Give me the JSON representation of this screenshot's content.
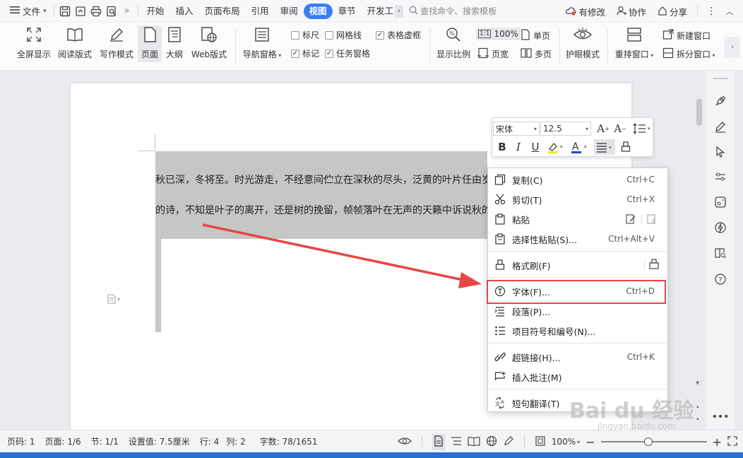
{
  "topbar": {
    "file_menu": "文件",
    "tabs": [
      "开始",
      "插入",
      "页面布局",
      "引用",
      "审阅",
      "视图",
      "章节",
      "开发工"
    ],
    "active_tab": "视图",
    "search_placeholder": "查找命令、搜索模板",
    "modified": "有修改",
    "collab": "协作",
    "share": "分享"
  },
  "ribbon": {
    "buttons": {
      "fullscreen": "全屏显示",
      "reading": "阅读版式",
      "writing": "写作模式",
      "page": "页面",
      "outline": "大纲",
      "web": "Web版式",
      "nav_pane": "导航窗格",
      "zoom_ratio": "显示比例",
      "eye_mode": "护眼模式",
      "rearrange": "重排窗口",
      "new_window": "新建窗口",
      "split_window": "拆分窗口"
    },
    "checks": {
      "ruler": {
        "label": "标尺",
        "checked": false
      },
      "gridlines": {
        "label": "网格线",
        "checked": false
      },
      "table_grid": {
        "label": "表格虚框",
        "checked": true
      },
      "marks": {
        "label": "标记",
        "checked": true
      },
      "task_pane": {
        "label": "任务窗格",
        "checked": true
      }
    },
    "zoom_100": "100%",
    "single_page": "单页",
    "page_width": "页宽",
    "multi_page": "多页"
  },
  "document": {
    "line1": "秋已深，冬将至。时光游走，不经意间伫立在深秋的尽头，泛黄的叶片任由岁",
    "line2": "的诗，不知是叶子的离开，还是树的挽留，帧帧落叶在无声的天籁中诉说秋的"
  },
  "mini_toolbar": {
    "font": "宋体",
    "size": "12.5"
  },
  "context_menu": {
    "items": [
      {
        "label": "复制(C)",
        "shortcut": "Ctrl+C"
      },
      {
        "label": "剪切(T)",
        "shortcut": "Ctrl+X"
      },
      {
        "label": "粘贴",
        "shortcut": ""
      },
      {
        "label": "选择性粘贴(S)...",
        "shortcut": "Ctrl+Alt+V"
      },
      {
        "label": "格式刷(F)",
        "shortcut": ""
      },
      {
        "label": "字体(F)...",
        "shortcut": "Ctrl+D"
      },
      {
        "label": "段落(P)...",
        "shortcut": ""
      },
      {
        "label": "项目符号和编号(N)...",
        "shortcut": ""
      },
      {
        "label": "超链接(H)...",
        "shortcut": "Ctrl+K"
      },
      {
        "label": "插入批注(M)",
        "shortcut": ""
      },
      {
        "label": "短句翻译(T)",
        "shortcut": ""
      }
    ]
  },
  "status_bar": {
    "page_num": "页码: 1",
    "pages": "页面: 1/6",
    "section": "节: 1/1",
    "setting": "设置值: 7.5厘米",
    "row": "行: 4",
    "col": "列: 2",
    "word_count": "字数: 78/1651",
    "zoom": "100%",
    "zoom_level": 0.45
  },
  "watermark": {
    "text": "Bai du 经验",
    "sub": "jingyan.baidu.com"
  },
  "colors": {
    "accent": "#3b7cf5",
    "highlight_red": "#e84545",
    "selection": "#c6c6c6"
  }
}
